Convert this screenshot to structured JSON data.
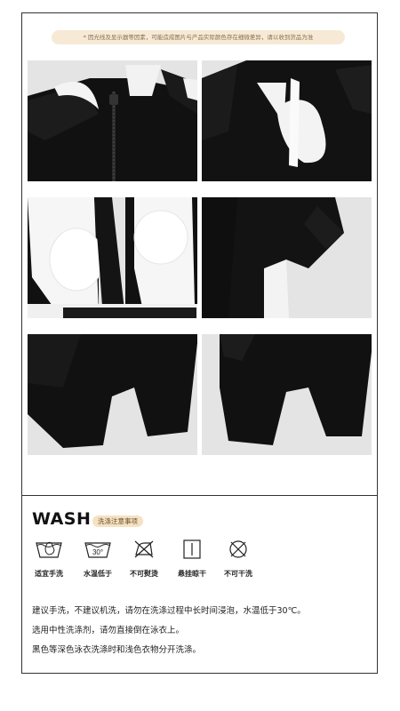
{
  "notice": "* 因光线及显示器等因素，可能造成图片与产品实际颜色存在细微差异，请以收到货品为准",
  "photos": [
    {
      "name": "zipper-collar-detail"
    },
    {
      "name": "keyhole-back-detail"
    },
    {
      "name": "padded-lining-detail"
    },
    {
      "name": "sleeve-detail"
    },
    {
      "name": "leg-front-detail"
    },
    {
      "name": "leg-back-detail"
    }
  ],
  "wash": {
    "title": "WASH",
    "subtitle": "洗涤注意事项",
    "care_items": [
      {
        "icon": "hand-wash-icon",
        "label": "适宜手洗"
      },
      {
        "icon": "water-temp-icon",
        "temp": "30°",
        "label": "水温低于"
      },
      {
        "icon": "no-iron-icon",
        "label": "不可熨烫"
      },
      {
        "icon": "hang-dry-icon",
        "label": "悬挂晾干"
      },
      {
        "icon": "no-tumble-dry-icon",
        "label": "不可干洗"
      }
    ],
    "notes": [
      "建议手洗，不建议机洗，请勿在洗涤过程中长时间浸泡，水温低于30℃。",
      "选用中性洗涤剂，请勿直接倒在泳衣上。",
      "黑色等深色泳衣洗涤时和浅色衣物分开洗涤。"
    ]
  },
  "colors": {
    "fabric": "#111111",
    "lining": "#f5f5f5",
    "accent": "#f4e2c3",
    "background": "#e6e6e6"
  }
}
